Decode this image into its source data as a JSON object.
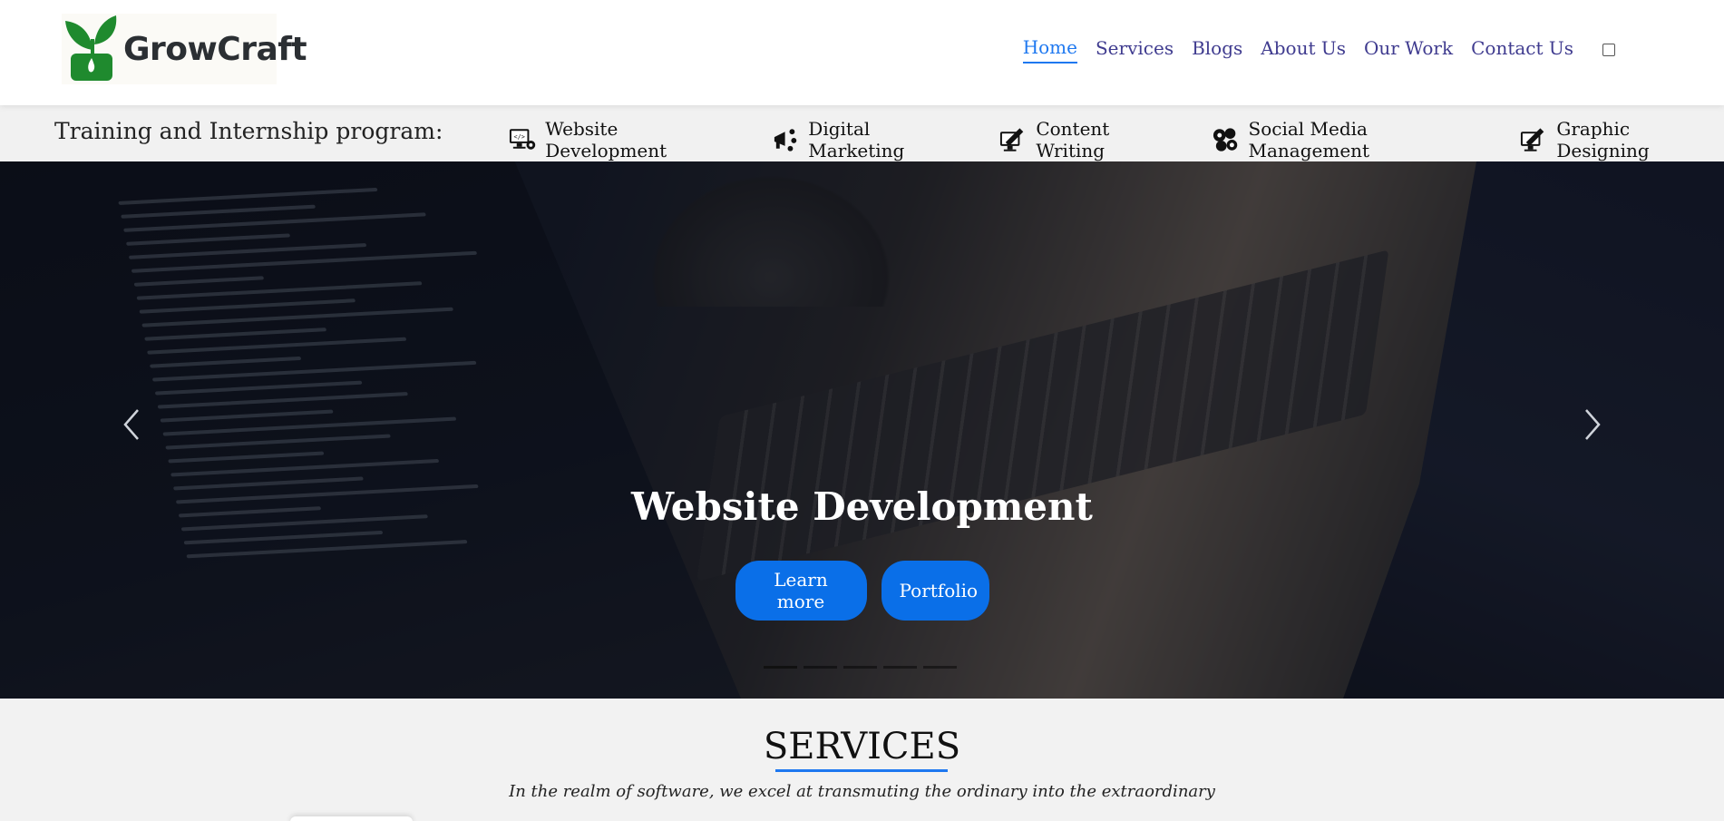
{
  "header": {
    "logo_text": "GrowCraft",
    "nav": [
      {
        "label": "Home",
        "active": true
      },
      {
        "label": "Services",
        "active": false
      },
      {
        "label": "Blogs",
        "active": false
      },
      {
        "label": "About Us",
        "active": false
      },
      {
        "label": "Our Work",
        "active": false
      },
      {
        "label": "Contact Us",
        "active": false
      }
    ]
  },
  "training": {
    "label": "Training and Internship program:",
    "programs": [
      {
        "label": "Website Development",
        "icon": "monitor-code-icon"
      },
      {
        "label": "Digital Marketing",
        "icon": "megaphone-icon"
      },
      {
        "label": "Content Writing",
        "icon": "monitor-pen-icon"
      },
      {
        "label": "Social Media Management",
        "icon": "social-network-icon"
      },
      {
        "label": "Graphic Designing",
        "icon": "monitor-pen-icon"
      }
    ]
  },
  "hero": {
    "title": "Website Development",
    "primary_button": "Learn more",
    "secondary_button": "Portfolio",
    "slides": 5,
    "active_slide": 1
  },
  "services": {
    "heading": "SERVICES",
    "subtitle": "In the realm of software, we excel at transmuting the ordinary into the extraordinary"
  },
  "colors": {
    "accent": "#1e78f0",
    "button": "#0a6fe8",
    "nav_text": "#3f3b8f",
    "logo_green": "#1f8a2e"
  }
}
